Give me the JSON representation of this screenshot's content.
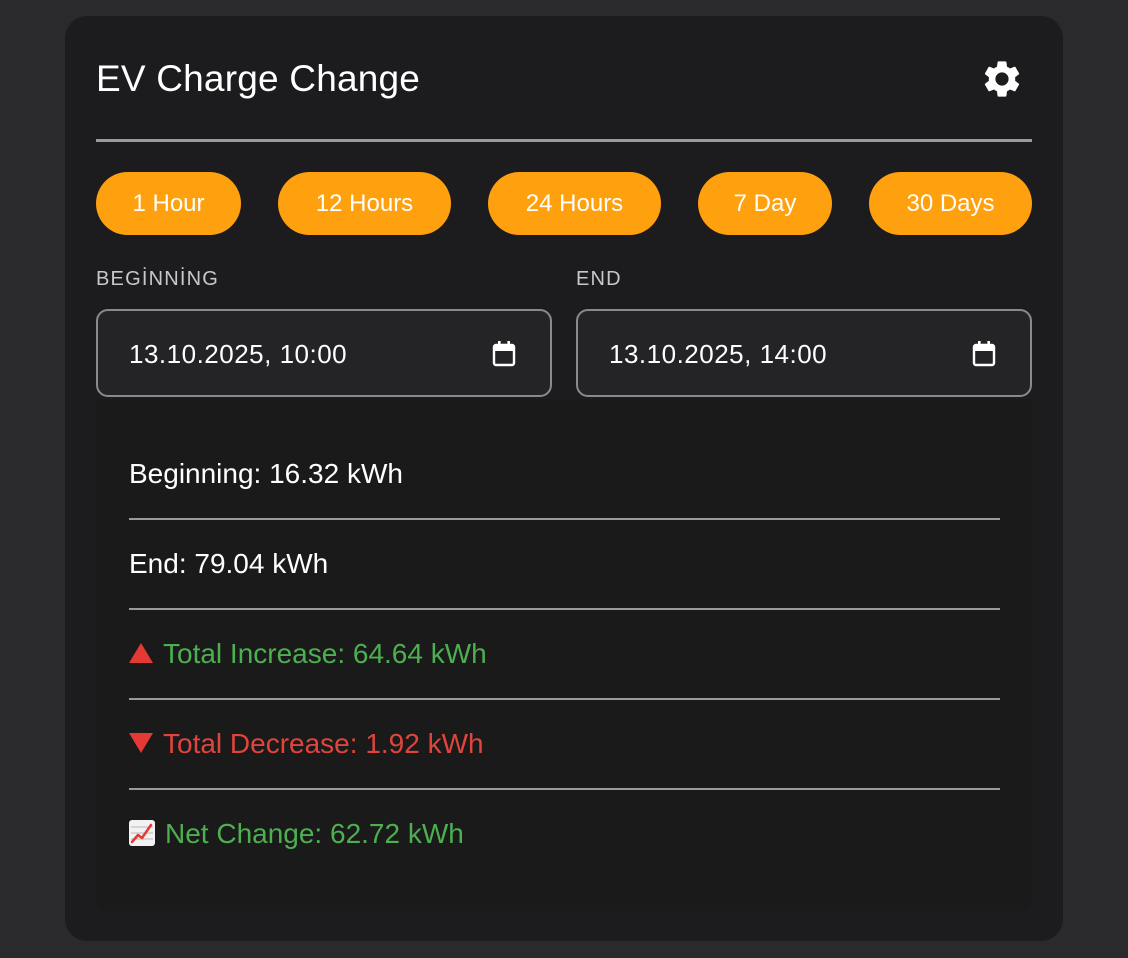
{
  "card": {
    "title": "EV Charge Change",
    "settings_icon": "gear-icon"
  },
  "ranges": [
    {
      "label": "1 Hour"
    },
    {
      "label": "12 Hours"
    },
    {
      "label": "24 Hours"
    },
    {
      "label": "7 Day"
    },
    {
      "label": "30 Days"
    }
  ],
  "range_color": "#ffa00f",
  "start": {
    "label": "BEGİNNİNG",
    "value": "13.10.2025, 10:00",
    "icon": "calendar-icon"
  },
  "end": {
    "label": "END",
    "value": "13.10.2025, 14:00",
    "icon": "calendar-icon"
  },
  "results": {
    "beginning": "Beginning: 16.32 kWh",
    "end": "End: 79.04 kWh",
    "increase": "Total Increase: 64.64 kWh",
    "increase_icon": "red-up-triangle-icon",
    "decrease": "Total Decrease: 1.92 kWh",
    "decrease_icon": "red-down-triangle-icon",
    "net": "Net Change: 62.72 kWh",
    "net_icon": "chart-increasing-icon"
  },
  "colors": {
    "increase": "#4caf50",
    "decrease": "#e0443c",
    "net": "#4caf50",
    "card_bg": "#1c1c1e",
    "page_bg": "#2a2a2c"
  }
}
